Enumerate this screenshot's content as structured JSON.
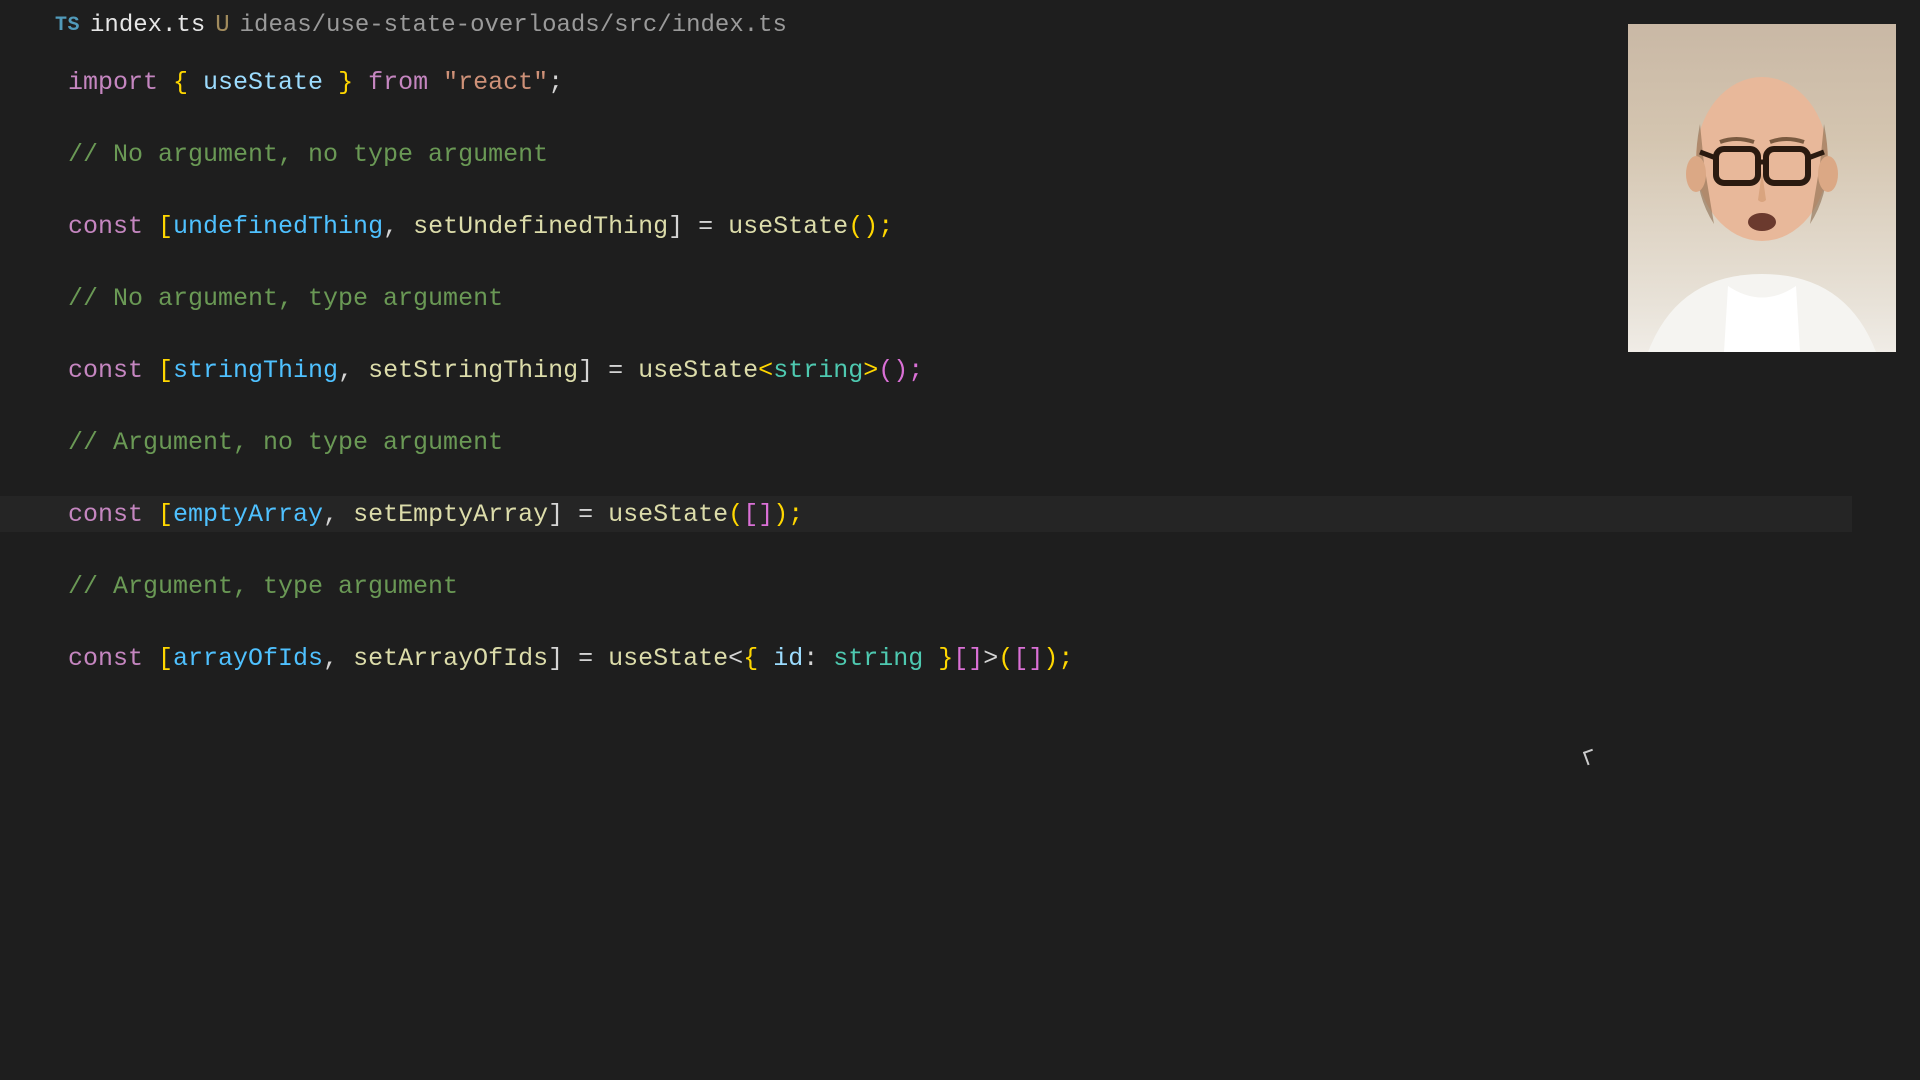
{
  "tab": {
    "lang_badge": "TS",
    "filename": "index.ts",
    "modified_indicator": "U",
    "filepath": "ideas/use-state-overloads/src/index.ts"
  },
  "code": {
    "line1": {
      "import": "import",
      "brace_open": " { ",
      "use_state": "useState",
      "brace_close": " } ",
      "from": "from",
      "space": " ",
      "react_str": "\"react\"",
      "semi": ";"
    },
    "comment1": "// No argument, no type argument",
    "line3": {
      "const": "const",
      "open": " [",
      "v1": "undefinedThing",
      "comma": ", ",
      "v2": "setUndefinedThing",
      "close": "] = ",
      "fn": "useState",
      "call": "();"
    },
    "comment2": "// No argument, type argument",
    "line5": {
      "const": "const",
      "open": " [",
      "v1": "stringThing",
      "comma": ", ",
      "v2": "setStringThing",
      "close": "] = ",
      "fn": "useState",
      "gen_open": "<",
      "type": "string",
      "gen_close": ">",
      "call": "();"
    },
    "comment3": "// Argument, no type argument",
    "line7": {
      "const": "const",
      "open": " [",
      "v1": "emptyArray",
      "comma": ", ",
      "v2": "setEmptyArray",
      "close": "] = ",
      "fn": "useState",
      "paren_open": "(",
      "arr": "[]",
      "paren_close": ");"
    },
    "comment4": "// Argument, type argument",
    "line9": {
      "const": "const",
      "open": " [",
      "v1": "arrayOfIds",
      "comma": ", ",
      "v2": "setArrayOfIds",
      "close": "] = ",
      "fn": "useState",
      "gen_open": "<",
      "brace_open": "{ ",
      "key": "id",
      "colon": ": ",
      "type": "string",
      "brace_close": " }",
      "arr_type": "[]",
      "gen_close": ">",
      "paren_open": "(",
      "arr": "[]",
      "paren_close": ");"
    }
  }
}
